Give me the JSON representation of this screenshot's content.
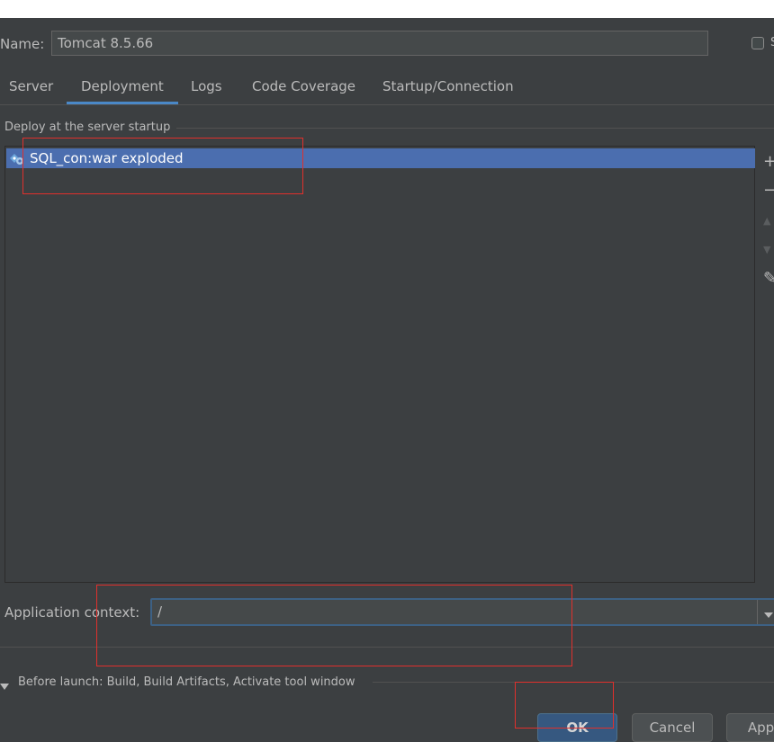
{
  "name_row": {
    "label": "Name:",
    "value": "Tomcat 8.5.66",
    "share_text": "S"
  },
  "tabs": [
    {
      "label": "Server"
    },
    {
      "label": "Deployment"
    },
    {
      "label": "Logs"
    },
    {
      "label": "Code Coverage"
    },
    {
      "label": "Startup/Connection"
    }
  ],
  "deploy": {
    "group_title": "Deploy at the server startup",
    "items": [
      {
        "label": "SQL_con:war exploded",
        "icon": "artifact-icon"
      }
    ]
  },
  "toolbar": {
    "add": "+",
    "remove": "−",
    "up": "▲",
    "down": "▼",
    "edit": "✎"
  },
  "app_context": {
    "label": "Application context:",
    "value": "/"
  },
  "before_launch": {
    "text": "Before launch: Build, Build Artifacts, Activate tool window"
  },
  "buttons": {
    "ok": "OK",
    "cancel": "Cancel",
    "apply": "Apply"
  },
  "colors": {
    "selection": "#4b6eaf",
    "accent": "#4a88c7",
    "annotation": "#e0302c"
  }
}
